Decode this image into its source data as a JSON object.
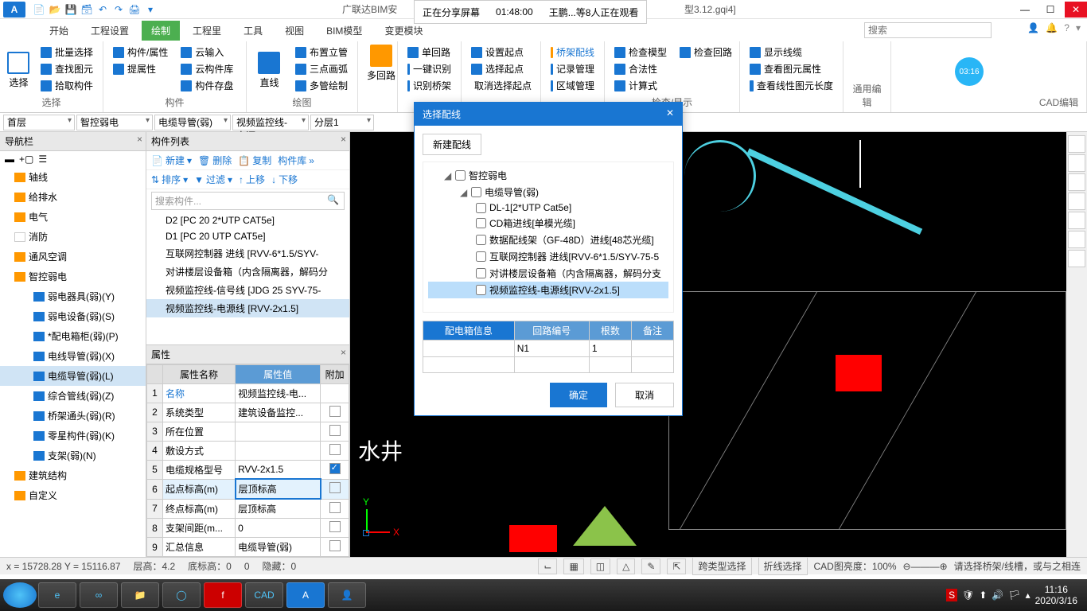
{
  "title_bar": {
    "app_letter": "A",
    "title": "广联达BIM安",
    "file_suffix": "型3.12.gqi4]",
    "share_status": "正在分享屏幕",
    "share_time": "01:48:00",
    "viewers": "王鹏...等8人正在观看"
  },
  "tabs": [
    "开始",
    "工程设置",
    "绘制",
    "工程里",
    "工具",
    "视图",
    "BIM模型",
    "变更模块"
  ],
  "search_placeholder": "搜索",
  "ribbon": {
    "select": {
      "big": "选择",
      "items": [
        "批量选择",
        "查找图元",
        "拾取构件"
      ],
      "label": "选择"
    },
    "component": {
      "items": [
        "构件/属性",
        "提属性",
        "云输入",
        "云构件库",
        "构件存盘"
      ],
      "label": "构件"
    },
    "draw": {
      "big": "直线",
      "items": [
        "布置立管",
        "三点画弧",
        "多管绘制"
      ],
      "label": "绘图"
    },
    "multi": {
      "big": "多回路"
    },
    "recog": {
      "items": [
        "单回路",
        "一键识别",
        "识别桥架"
      ]
    },
    "setpt": {
      "items": [
        "设置起点",
        "选择起点",
        "取消选择起点"
      ]
    },
    "bridge": {
      "items": [
        "桥架配线",
        "记录管理",
        "区域管理"
      ]
    },
    "check": {
      "items": [
        "检查模型",
        "检查回路",
        "合法性",
        "计算式"
      ],
      "label": "检查/显示"
    },
    "display": {
      "items": [
        "显示线缆",
        "查看图元属性",
        "查看线性图元长度"
      ]
    },
    "edit": {
      "label": "通用编辑"
    },
    "cad": {
      "label": "CAD编辑"
    },
    "timer": "03:16"
  },
  "dropdowns": [
    "首层",
    "智控弱电",
    "电缆导管(弱)",
    "视频监控线-电源",
    "分层1"
  ],
  "nav": {
    "title": "导航栏",
    "items": [
      {
        "label": "轴线",
        "lvl": 1
      },
      {
        "label": "给排水",
        "lvl": 1
      },
      {
        "label": "电气",
        "lvl": 1
      },
      {
        "label": "消防",
        "lvl": 1
      },
      {
        "label": "通风空调",
        "lvl": 1
      },
      {
        "label": "智控弱电",
        "lvl": 1,
        "sel": true
      },
      {
        "label": "弱电器具(弱)(Y)",
        "lvl": 2
      },
      {
        "label": "弱电设备(弱)(S)",
        "lvl": 2
      },
      {
        "label": "*配电箱柜(弱)(P)",
        "lvl": 2
      },
      {
        "label": "电线导管(弱)(X)",
        "lvl": 2
      },
      {
        "label": "电缆导管(弱)(L)",
        "lvl": 2,
        "sel": true
      },
      {
        "label": "综合管线(弱)(Z)",
        "lvl": 2
      },
      {
        "label": "桥架通头(弱)(R)",
        "lvl": 2
      },
      {
        "label": "零星构件(弱)(K)",
        "lvl": 2
      },
      {
        "label": "支架(弱)(N)",
        "lvl": 2
      },
      {
        "label": "建筑结构",
        "lvl": 1
      },
      {
        "label": "自定义",
        "lvl": 1
      }
    ]
  },
  "complist": {
    "title": "构件列表",
    "toolbar": {
      "new": "新建",
      "del": "删除",
      "copy": "复制",
      "lib": "构件库"
    },
    "toolbar2": {
      "sort": "排序",
      "filter": "过滤",
      "up": "上移",
      "down": "下移"
    },
    "search": "搜索构件...",
    "items": [
      "D2 [PC 20 2*UTP CAT5e]",
      "D1 [PC 20 UTP CAT5e]",
      "互联网控制器 进线 [RVV-6*1.5/SYV-",
      "对讲楼层设备箱（内含隔离器，解码分",
      "视频监控线-信号线 [JDG 25 SYV-75-",
      "视频监控线-电源线 [RVV-2x1.5]"
    ],
    "sel_index": 5
  },
  "props": {
    "title": "属性",
    "headers": [
      "属性名称",
      "属性值",
      "附加"
    ],
    "rows": [
      {
        "n": "1",
        "name": "名称",
        "val": "视频监控线-电...",
        "chk": false,
        "blue": true
      },
      {
        "n": "2",
        "name": "系统类型",
        "val": "建筑设备监控...",
        "chk": false
      },
      {
        "n": "3",
        "name": "所在位置",
        "val": "",
        "chk": false
      },
      {
        "n": "4",
        "name": "敷设方式",
        "val": "",
        "chk": false
      },
      {
        "n": "5",
        "name": "电缆规格型号",
        "val": "RVV-2x1.5",
        "chk": true
      },
      {
        "n": "6",
        "name": "起点标高(m)",
        "val": "层顶标高",
        "chk": false,
        "hl": true
      },
      {
        "n": "7",
        "name": "终点标高(m)",
        "val": "层顶标高",
        "chk": false
      },
      {
        "n": "8",
        "name": "支架间距(m...",
        "val": "0",
        "chk": false
      },
      {
        "n": "9",
        "name": "汇总信息",
        "val": "电缆导管(弱)",
        "chk": false
      }
    ]
  },
  "dialog": {
    "title": "选择配线",
    "new_btn": "新建配线",
    "tree": [
      {
        "label": "智控弱电",
        "lvl": 1
      },
      {
        "label": "电缆导管(弱)",
        "lvl": 2
      },
      {
        "label": "DL-1[2*UTP Cat5e]",
        "lvl": 3
      },
      {
        "label": "CD箱进线[单模光缆]",
        "lvl": 3
      },
      {
        "label": "数据配线架（GF-48D）进线[48芯光缆]",
        "lvl": 3
      },
      {
        "label": "互联网控制器 进线[RVV-6*1.5/SYV-75-5",
        "lvl": 3
      },
      {
        "label": "对讲楼层设备箱（内含隔离器，解码分支",
        "lvl": 3
      },
      {
        "label": "视频监控线-电源线[RVV-2x1.5]",
        "lvl": 3,
        "sel": true
      }
    ],
    "table_headers": [
      "配电箱信息",
      "回路编号",
      "根数",
      "备注"
    ],
    "table_row": {
      "col2": "N1",
      "col3": "1"
    },
    "ok": "确定",
    "cancel": "取消"
  },
  "status": {
    "coords": "x = 15728.28 Y = 15116.87",
    "floor": "层高：4.2",
    "base": "底标高：0",
    "zero": "0",
    "hidden": "隐藏：0",
    "cross": "跨类型选择",
    "broken": "折线选择",
    "bright": "CAD图亮度：100%",
    "hint": "请选择桥架/线槽，或与之相连"
  },
  "taskbar": {
    "time": "11:16",
    "date": "2020/3/16"
  }
}
